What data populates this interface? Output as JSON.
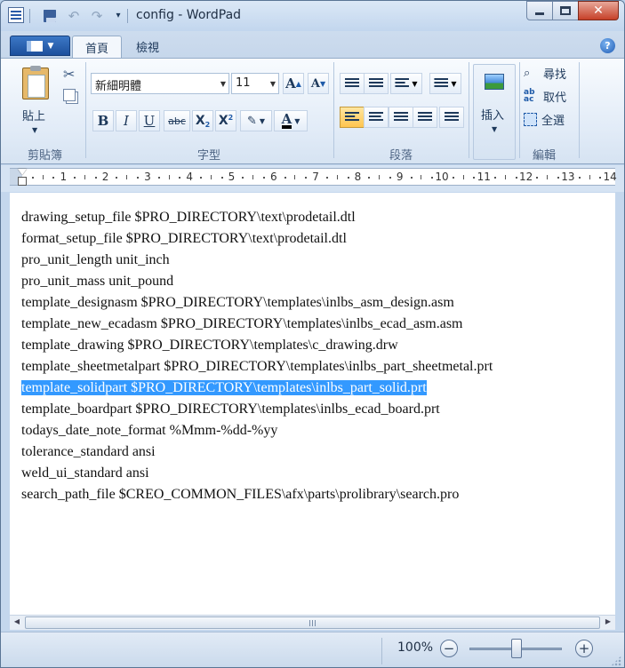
{
  "window": {
    "title": "config - WordPad"
  },
  "qat": {
    "undo_glyph": "↶",
    "redo_glyph": "↷",
    "more_glyph": "▾"
  },
  "ribbon": {
    "tabs": [
      {
        "label": "首頁"
      },
      {
        "label": "檢視"
      }
    ],
    "clipboard": {
      "paste_label": "貼上",
      "group_label": "剪貼簿"
    },
    "font": {
      "font_name": "新細明體",
      "font_size": "11",
      "group_label": "字型"
    },
    "paragraph": {
      "group_label": "段落"
    },
    "insert": {
      "label": "插入"
    },
    "editing": {
      "find": "尋找",
      "replace": "取代",
      "select_all": "全選",
      "group_label": "編輯"
    }
  },
  "ruler": {
    "numbers": [
      "1",
      "2",
      "3",
      "4",
      "5",
      "6",
      "7",
      "8",
      "9",
      "10",
      "11",
      "12",
      "13",
      "14"
    ]
  },
  "document": {
    "lines": [
      "drawing_setup_file $PRO_DIRECTORY\\text\\prodetail.dtl",
      "format_setup_file $PRO_DIRECTORY\\text\\prodetail.dtl",
      "pro_unit_length unit_inch",
      "pro_unit_mass unit_pound",
      "template_designasm $PRO_DIRECTORY\\templates\\inlbs_asm_design.asm",
      "template_new_ecadasm $PRO_DIRECTORY\\templates\\inlbs_ecad_asm.asm",
      "template_drawing $PRO_DIRECTORY\\templates\\c_drawing.drw",
      "template_sheetmetalpart $PRO_DIRECTORY\\templates\\inlbs_part_sheetmetal.prt",
      "template_solidpart $PRO_DIRECTORY\\templates\\inlbs_part_solid.prt",
      "template_boardpart $PRO_DIRECTORY\\templates\\inlbs_ecad_board.prt",
      "todays_date_note_format %Mmm-%dd-%yy",
      "tolerance_standard ansi",
      "weld_ui_standard ansi",
      "search_path_file $CREO_COMMON_FILES\\afx\\parts\\prolibrary\\search.pro"
    ],
    "selected_line_index": 8
  },
  "statusbar": {
    "zoom": "100%"
  },
  "colors": {
    "selection": "#3399ff",
    "close_button": "#c64028",
    "active_alignment": "#ffc54f"
  }
}
